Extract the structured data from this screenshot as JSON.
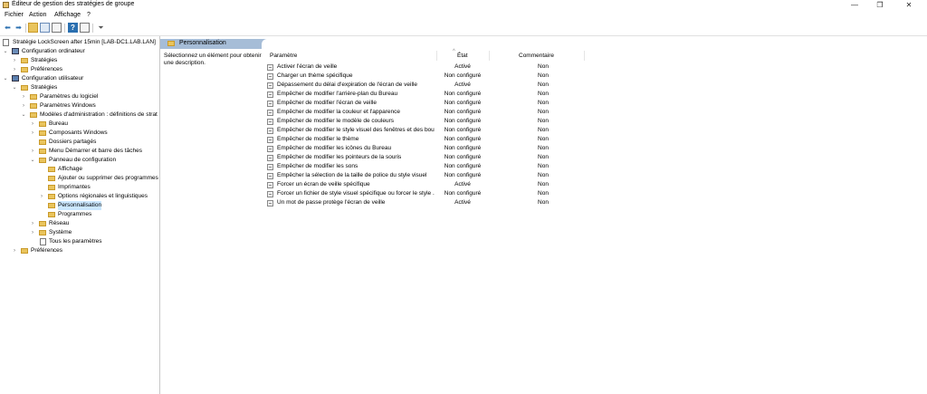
{
  "window": {
    "title": "Éditeur de gestion des stratégies de groupe",
    "minimize": "—",
    "maximize": "❐",
    "close": "✕"
  },
  "menu": [
    "Fichier",
    "Action",
    "Affichage",
    "?"
  ],
  "toolbar": {
    "icons": [
      "back-arrow-icon",
      "forward-arrow-icon",
      "up-folder-icon",
      "show-tree-icon",
      "export-list-icon",
      "help-icon",
      "properties-icon",
      "filter-icon"
    ]
  },
  "tree": {
    "root": "Stratégie LockScreen after 15min [LAB-DC1.LAB.LAN]",
    "items": [
      "Configuration ordinateur",
      "Stratégies",
      "Préférences",
      "Configuration utilisateur",
      "Stratégies",
      "Paramètres du logiciel",
      "Paramètres Windows",
      "Modèles d'administration : définitions de strat",
      "Bureau",
      "Composants Windows",
      "Dossiers partagés",
      "Menu Démarrer et barre des tâches",
      "Panneau de configuration",
      "Affichage",
      "Ajouter ou supprimer des programmes",
      "Imprimantes",
      "Options régionales et linguistiques",
      "Personnalisation",
      "Programmes",
      "Réseau",
      "Système",
      "Tous les paramètres",
      "Préférences"
    ]
  },
  "panel": {
    "header": "Personnalisation",
    "description": "Sélectionnez un élément pour obtenir une description.",
    "columns": {
      "setting": "Paramètre",
      "state": "État",
      "comment": "Commentaire"
    },
    "rows": [
      {
        "name": "Activer l'écran de veille",
        "state": "Activé",
        "comment": "Non"
      },
      {
        "name": "Charger un thème spécifique",
        "state": "Non configuré",
        "comment": "Non"
      },
      {
        "name": "Dépassement du délai d'expiration de l'écran de veille",
        "state": "Activé",
        "comment": "Non"
      },
      {
        "name": "Empêcher de modifier l'arrière-plan du Bureau",
        "state": "Non configuré",
        "comment": "Non"
      },
      {
        "name": "Empêcher de modifier l'écran de veille",
        "state": "Non configuré",
        "comment": "Non"
      },
      {
        "name": "Empêcher de modifier la couleur et l'apparence",
        "state": "Non configuré",
        "comment": "Non"
      },
      {
        "name": "Empêcher de modifier le modèle de couleurs",
        "state": "Non configuré",
        "comment": "Non"
      },
      {
        "name": "Empêcher de modifier le style visuel des fenêtres et des bout...",
        "state": "Non configuré",
        "comment": "Non"
      },
      {
        "name": "Empêcher de modifier le thème",
        "state": "Non configuré",
        "comment": "Non"
      },
      {
        "name": "Empêcher de modifier les icônes du Bureau",
        "state": "Non configuré",
        "comment": "Non"
      },
      {
        "name": "Empêcher de modifier les pointeurs de la souris",
        "state": "Non configuré",
        "comment": "Non"
      },
      {
        "name": "Empêcher de modifier les sons",
        "state": "Non configuré",
        "comment": "Non"
      },
      {
        "name": "Empêcher la sélection de la taille de police du style visuel",
        "state": "Non configuré",
        "comment": "Non"
      },
      {
        "name": "Forcer un écran de veille spécifique",
        "state": "Activé",
        "comment": "Non"
      },
      {
        "name": "Forcer un fichier de style visuel spécifique ou forcer le style ...",
        "state": "Non configuré",
        "comment": "Non"
      },
      {
        "name": "Un mot de passe protège l'écran de veille",
        "state": "Activé",
        "comment": "Non"
      }
    ]
  },
  "colors": {
    "header_band": "#a6bdd7",
    "selection": "#cce8ff"
  }
}
